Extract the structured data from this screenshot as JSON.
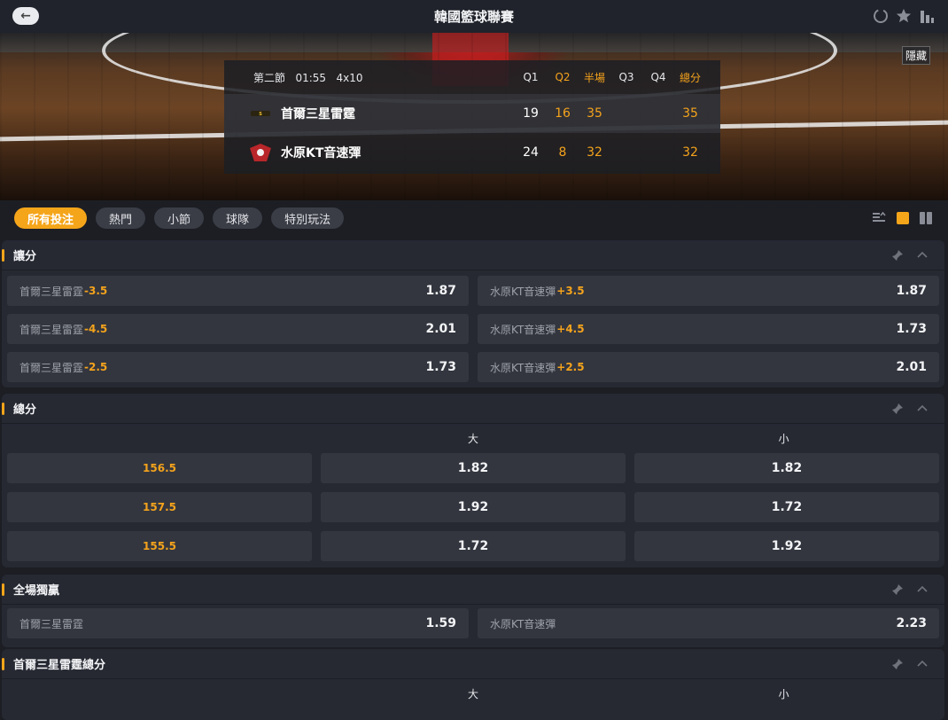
{
  "header": {
    "title": "韓國籃球聯賽",
    "back_icon": "arrow-left-icon",
    "icons": [
      "refresh-icon",
      "star-icon",
      "stats-icon"
    ]
  },
  "banner": {
    "hide_label": "隱藏"
  },
  "scoreboard": {
    "period": "第二節",
    "clock": "01:55",
    "format": "4x10",
    "columns": [
      "Q1",
      "Q2",
      "半場",
      "Q3",
      "Q4",
      "總分"
    ],
    "teams": [
      {
        "name": "首爾三星雷霆",
        "scores": [
          "19",
          "16",
          "35",
          "",
          "",
          "35"
        ]
      },
      {
        "name": "水原KT音速彈",
        "scores": [
          "24",
          "8",
          "32",
          "",
          "",
          "32"
        ]
      }
    ]
  },
  "filters": {
    "chips": [
      "所有投注",
      "熱門",
      "小節",
      "球隊",
      "特別玩法"
    ],
    "active": "所有投注"
  },
  "handicap": {
    "title": "讓分",
    "rows": [
      {
        "home": "首爾三星雷霆",
        "home_line": "-3.5",
        "home_odds": "1.87",
        "away": "水原KT音速彈",
        "away_line": "+3.5",
        "away_odds": "1.87"
      },
      {
        "home": "首爾三星雷霆",
        "home_line": "-4.5",
        "home_odds": "2.01",
        "away": "水原KT音速彈",
        "away_line": "+4.5",
        "away_odds": "1.73"
      },
      {
        "home": "首爾三星雷霆",
        "home_line": "-2.5",
        "home_odds": "1.73",
        "away": "水原KT音速彈",
        "away_line": "+2.5",
        "away_odds": "2.01"
      }
    ]
  },
  "totals": {
    "title": "總分",
    "over_label": "大",
    "under_label": "小",
    "rows": [
      {
        "line": "156.5",
        "over": "1.82",
        "under": "1.82"
      },
      {
        "line": "157.5",
        "over": "1.92",
        "under": "1.72"
      },
      {
        "line": "155.5",
        "over": "1.72",
        "under": "1.92"
      }
    ]
  },
  "moneyline": {
    "title": "全場獨贏",
    "home": "首爾三星雷霆",
    "home_odds": "1.59",
    "away": "水原KT音速彈",
    "away_odds": "2.23"
  },
  "team_total": {
    "title": "首爾三星雷霆總分",
    "over_label": "大",
    "under_label": "小"
  },
  "colors": {
    "accent": "#f5a51a",
    "background": "#1c1e24",
    "panel": "#262932",
    "cell": "#33363f"
  }
}
